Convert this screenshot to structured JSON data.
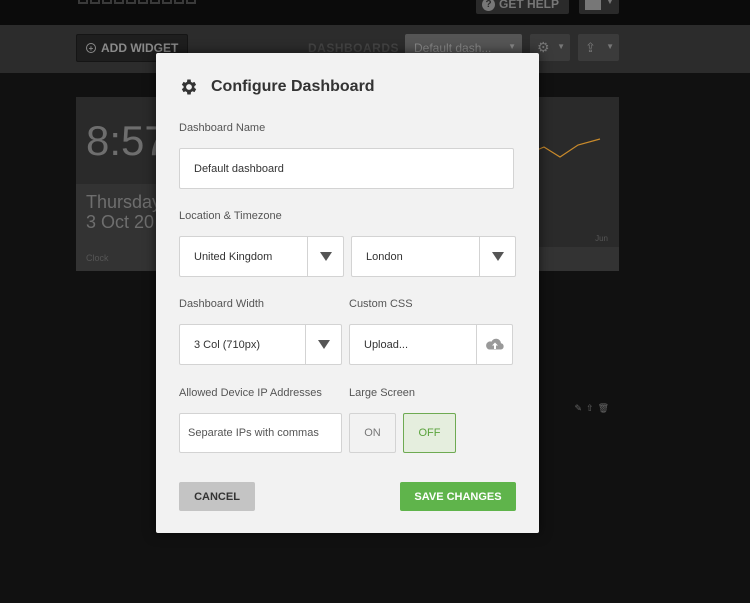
{
  "topbar": {
    "help_label": "GET HELP",
    "help_icon": "question-circle-icon"
  },
  "toolbar": {
    "add_widget_label": "ADD WIDGET",
    "dashboards_label": "DASHBOARDS",
    "dashboard_select_value": "Default dash...",
    "settings_icon": "gear-icon",
    "share_icon": "share-icon"
  },
  "background": {
    "clock": {
      "time": "8:57",
      "day": "Thursday",
      "date": "3 Oct 20",
      "label": "Clock"
    },
    "chart": {
      "month_label": "Jun"
    }
  },
  "modal": {
    "title": "Configure Dashboard",
    "dashboard_name": {
      "label": "Dashboard Name",
      "value": "Default dashboard"
    },
    "location": {
      "label": "Location & Timezone",
      "country": "United Kingdom",
      "city": "London"
    },
    "width": {
      "label": "Dashboard Width",
      "value": "3 Col (710px)"
    },
    "custom_css": {
      "label": "Custom CSS",
      "value": "Upload..."
    },
    "ip": {
      "label": "Allowed Device IP Addresses",
      "placeholder": "Separate IPs with commas"
    },
    "large_screen": {
      "label": "Large Screen",
      "on_label": "ON",
      "off_label": "OFF",
      "selected": "OFF"
    },
    "cancel_label": "CANCEL",
    "save_label": "SAVE CHANGES"
  },
  "colors": {
    "accent_green": "#5fb44b",
    "chart_line": "#c98a2b"
  }
}
